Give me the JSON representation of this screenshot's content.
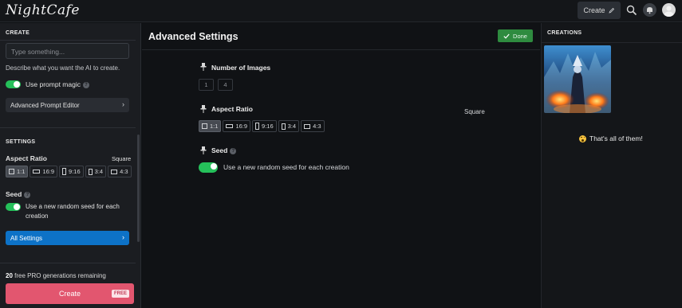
{
  "app": {
    "logo": "NightCafe"
  },
  "topbar": {
    "create_label": "Create",
    "icons": [
      "search-icon",
      "bell-icon",
      "avatar"
    ]
  },
  "left": {
    "create_heading": "CREATE",
    "prompt_placeholder": "Type something...",
    "prompt_desc": "Describe what you want the AI to create.",
    "prompt_magic_label": "Use prompt magic",
    "prompt_magic_on": true,
    "advanced_editor_label": "Advanced Prompt Editor",
    "settings_heading": "SETTINGS",
    "aspect_ratio_label": "Aspect Ratio",
    "aspect_ratio_value": "Square",
    "aspect_options": [
      "1:1",
      "16:9",
      "9:16",
      "3:4",
      "4:3"
    ],
    "selected_aspect": "1:1",
    "seed_label": "Seed",
    "seed_desc": "Use a new random seed for each creation",
    "seed_on": true,
    "all_settings_label": "All Settings",
    "remaining_count": "20",
    "remaining_text": "free PRO generations remaining",
    "create_button_label": "Create",
    "free_badge": "FREE"
  },
  "center": {
    "title": "Advanced Settings",
    "done_label": "Done",
    "num_images_label": "Number of Images",
    "num_options": [
      "1",
      "4"
    ],
    "aspect_ratio_label": "Aspect Ratio",
    "aspect_ratio_value": "Square",
    "aspect_options": [
      "1:1",
      "16:9",
      "9:16",
      "3:4",
      "4:3"
    ],
    "seed_label": "Seed",
    "seed_desc": "Use a new random seed for each creation",
    "seed_on": true
  },
  "right": {
    "heading": "CREATIONS",
    "end_message": "That's all of them!"
  },
  "colors": {
    "accent_green": "#25c05a",
    "create_pink": "#e2566f",
    "all_settings_blue": "#0d72c7",
    "done_green": "#2e8b3f"
  }
}
